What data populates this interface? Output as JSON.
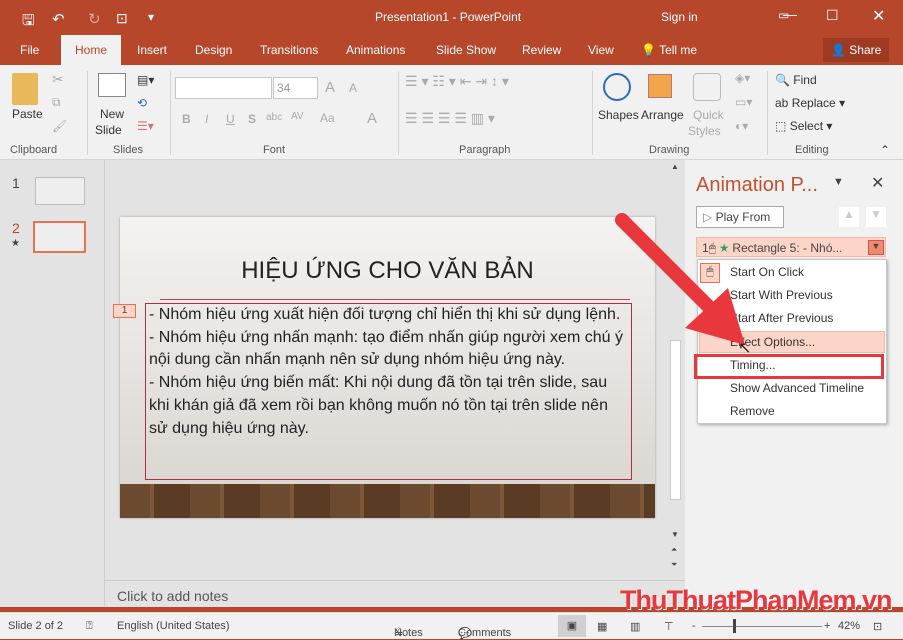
{
  "title_bar": {
    "title": "Presentation1  -  PowerPoint",
    "sign_in": "Sign in",
    "icons": [
      "save-icon",
      "undo-icon",
      "redo-icon",
      "present-icon",
      "customize-icon",
      "ribbon-display-icon",
      "minimize-icon",
      "maximize-icon",
      "close-icon"
    ]
  },
  "tabs": [
    "File",
    "Home",
    "Insert",
    "Design",
    "Transitions",
    "Animations",
    "Slide Show",
    "Review",
    "View",
    "Tell me",
    "Share"
  ],
  "ribbon": {
    "paste": "Paste",
    "new_slide_1": "New",
    "new_slide_2": "Slide",
    "font_size": "34",
    "find": "Find",
    "replace": "Replace",
    "select": "Select",
    "shapes": "Shapes",
    "arrange": "Arrange",
    "quick_styles_1": "Quick",
    "quick_styles_2": "Styles",
    "groups": [
      "Clipboard",
      "Slides",
      "Font",
      "Paragraph",
      "Drawing",
      "Editing"
    ],
    "font_buttons": [
      "B",
      "I",
      "U",
      "S",
      "abc",
      "AV",
      "Aa",
      "A"
    ]
  },
  "thumbnails": [
    {
      "number": "1"
    },
    {
      "number": "2",
      "star": "★"
    }
  ],
  "slide": {
    "title": "HIỆU ỨNG CHO VĂN BẢN",
    "anim_tag": "1",
    "body": [
      "- Nhóm hiệu ứng xuất hiện đối tượng chỉ hiển thị khi sử dụng lệnh.",
      "- Nhóm hiệu ứng nhấn mạnh: tạo điểm nhấn giúp người xem chú ý nội dung cần nhấn mạnh nên sử dụng nhóm hiệu ứng này.",
      "- Nhóm hiệu ứng biến mất: Khi nội dung đã tồn tại trên slide, sau khi khán giả đã xem rồi bạn không muốn nó tồn tại trên slide nên sử dụng hiệu ứng này."
    ]
  },
  "notes_placeholder": "Click to add notes",
  "animation_pane": {
    "title": "Animation P...",
    "play_from": "Play From",
    "item": {
      "number": "1",
      "label": "Rectangle 5: - Nhó..."
    },
    "menu": [
      "Start On Click",
      "Start With Previous",
      "Start After Previous",
      "Effect Options...",
      "Timing...",
      "Show Advanced Timeline",
      "Remove"
    ],
    "highlighted": "Timing..."
  },
  "status": {
    "slide": "Slide 2 of 2",
    "language": "English (United States)",
    "notes": "Notes",
    "comments": "Comments",
    "zoom": "42%",
    "zoom_percent": 42
  },
  "watermark": "ThuThuatPhanMem.vn",
  "colors": {
    "accent": "#b7472a",
    "arrow": "#e8383d",
    "highlight": "#fcd5c8"
  }
}
